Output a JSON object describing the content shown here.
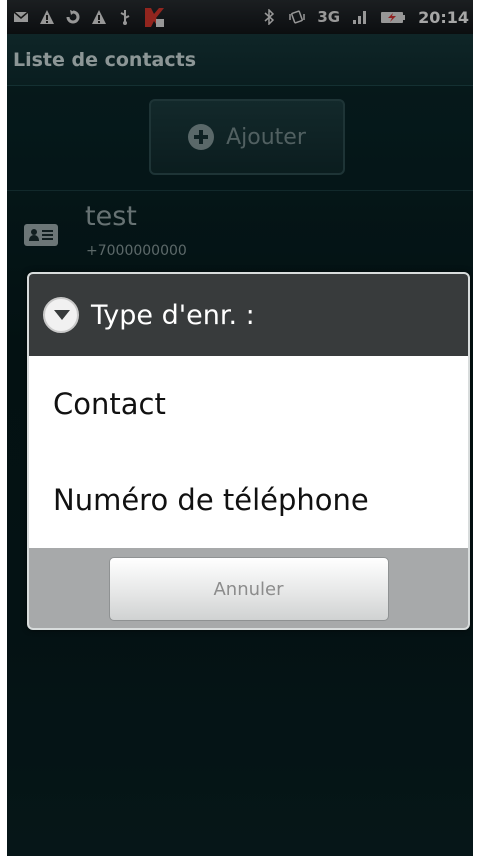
{
  "status_bar": {
    "left_icons": [
      "mail-icon",
      "warning-icon",
      "sync-icon",
      "warning-icon",
      "usb-icon",
      "antivirus-icon"
    ],
    "right_icons": [
      "bluetooth-icon",
      "vibrate-icon",
      "network-3g-icon",
      "signal-icon",
      "battery-charging-icon"
    ],
    "network_label": "3G",
    "time": "20:14"
  },
  "header": {
    "title": "Liste de contacts"
  },
  "add_button": {
    "label": "Ajouter"
  },
  "contact": {
    "name": "test",
    "phone": "+7000000000"
  },
  "dialog": {
    "title": "Type d'enr. :",
    "options": [
      "Contact",
      "Numéro de téléphone"
    ],
    "cancel_label": "Annuler"
  },
  "colors": {
    "background": "#071c1f",
    "dialog_header": "#383b3c",
    "dialog_footer": "#a7a9aa"
  }
}
